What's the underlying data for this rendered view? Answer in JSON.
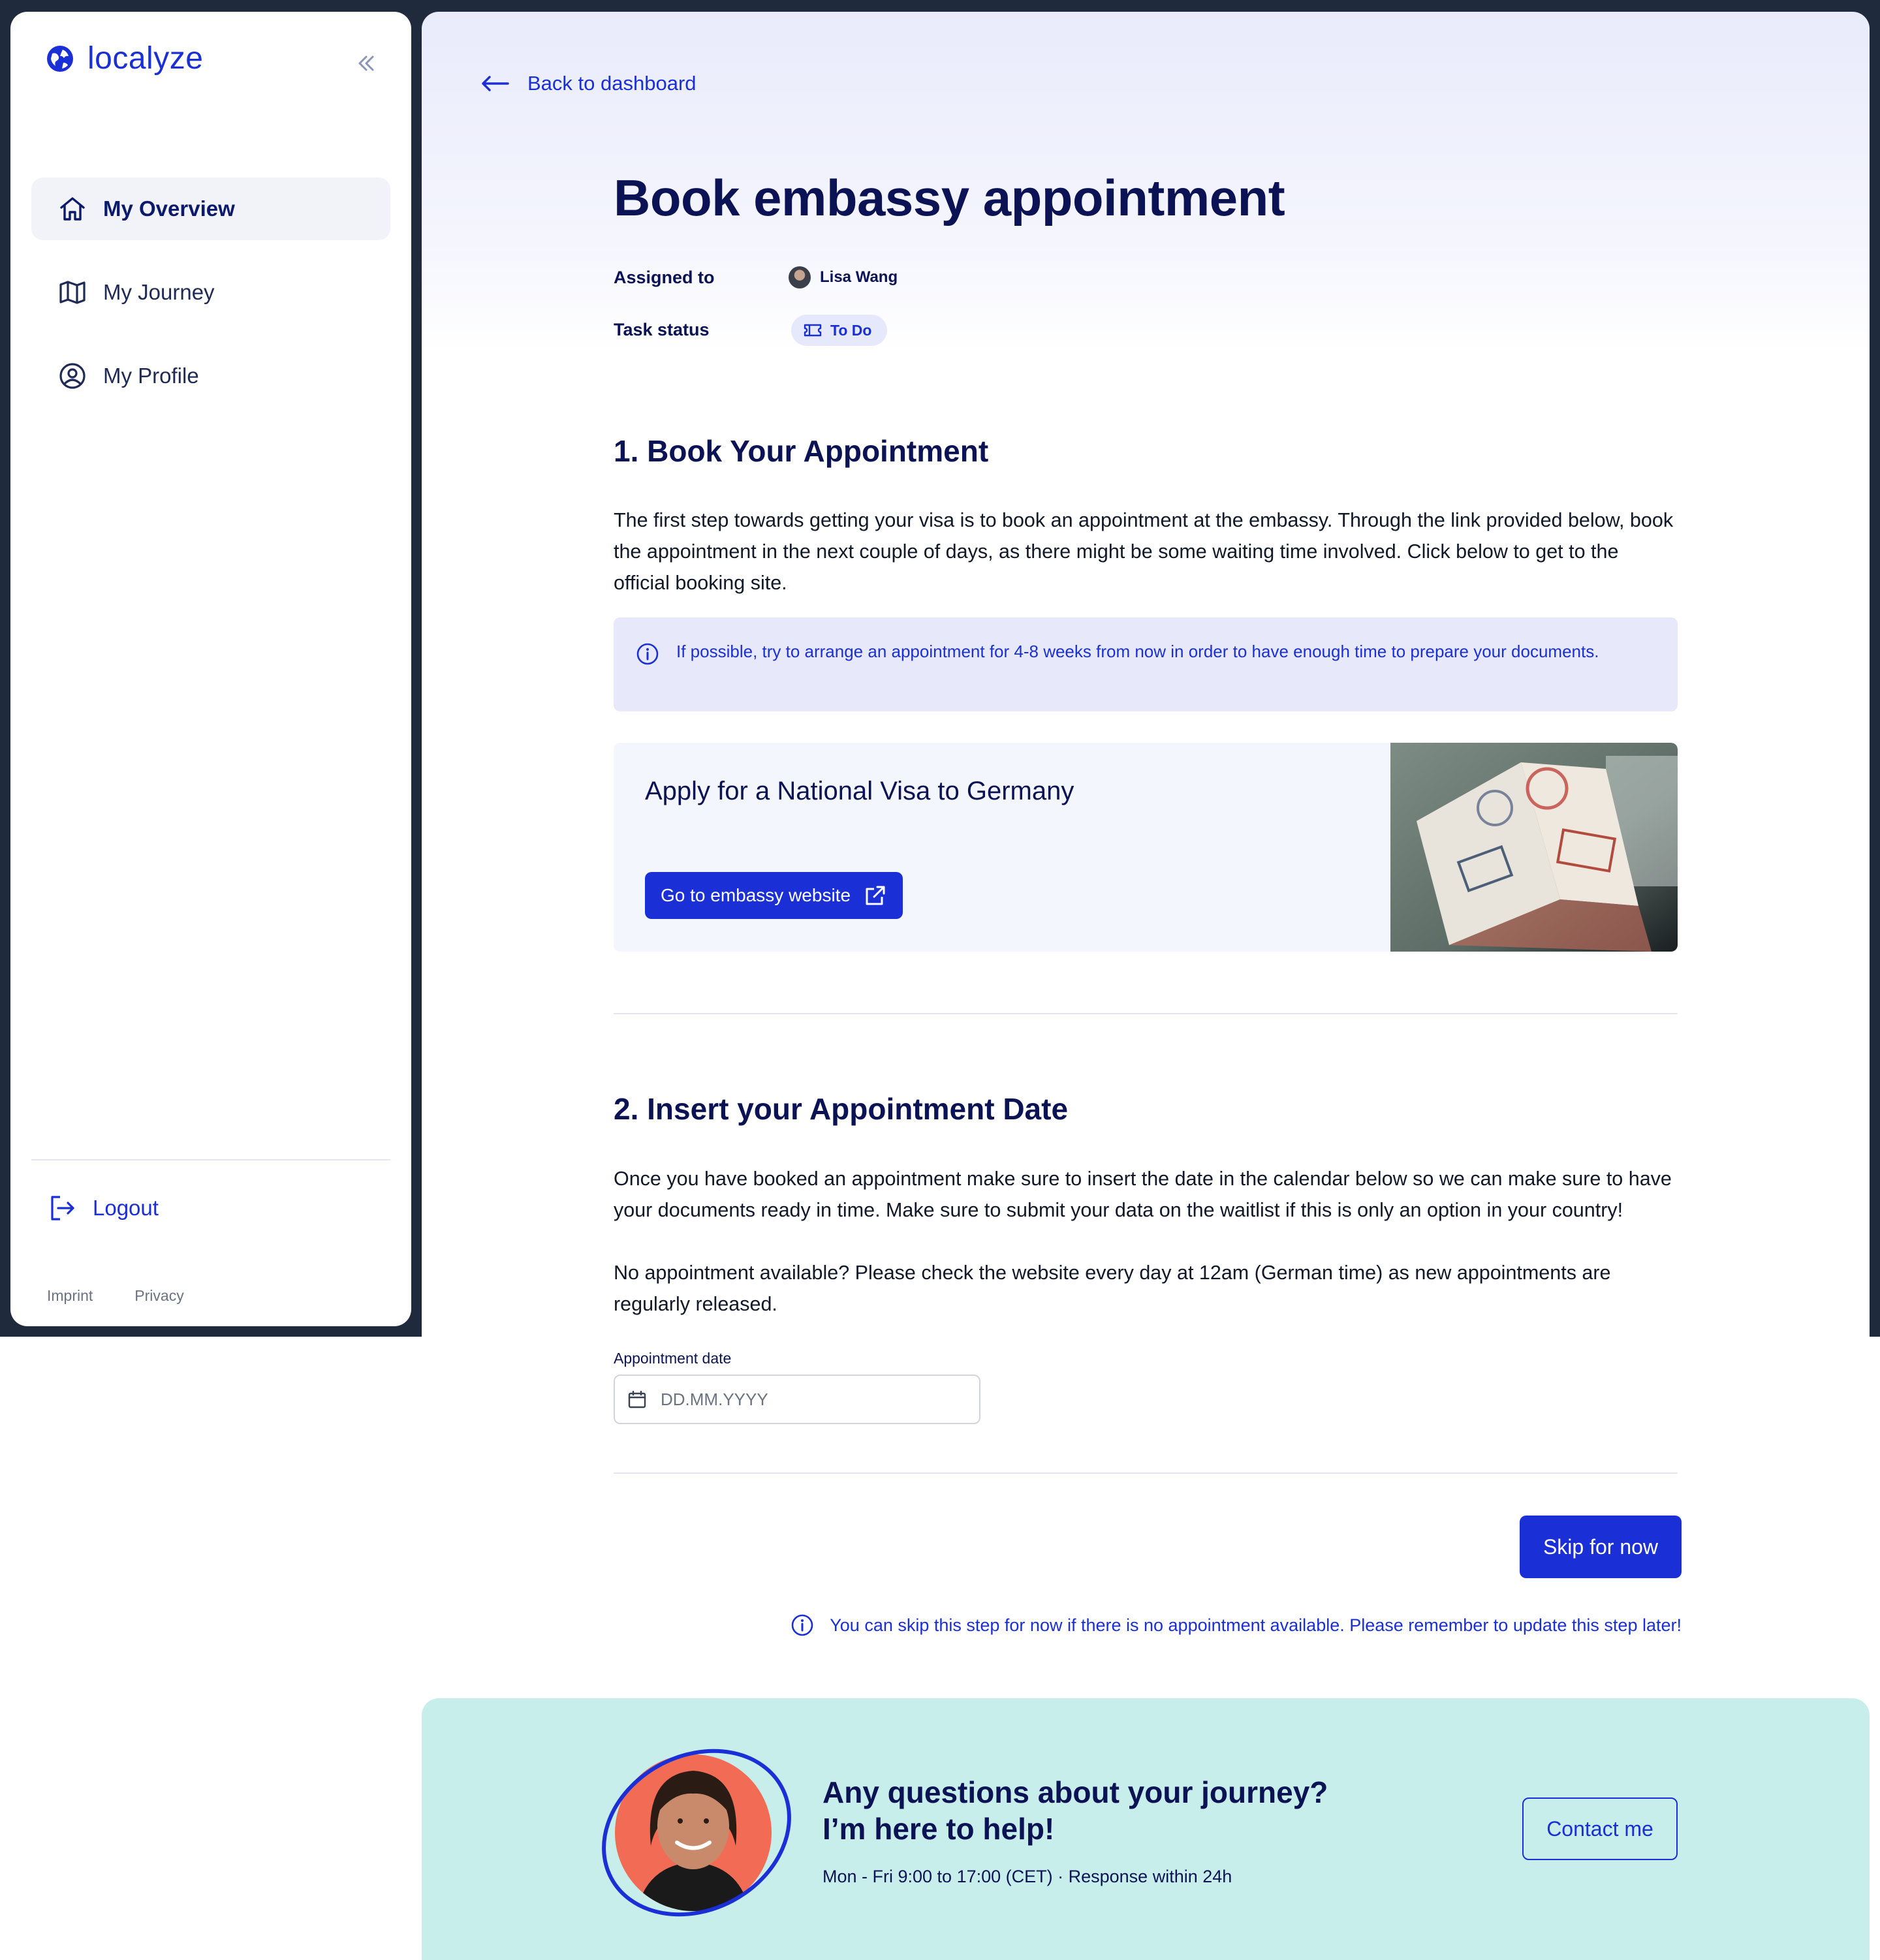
{
  "brand": {
    "name": "localyze"
  },
  "sidebar": {
    "items": [
      {
        "label": "My Overview",
        "icon": "home-icon",
        "active": true
      },
      {
        "label": "My Journey",
        "icon": "map-icon",
        "active": false
      },
      {
        "label": "My Profile",
        "icon": "user-circle-icon",
        "active": false
      }
    ],
    "logout_label": "Logout",
    "footer_links": [
      "Imprint",
      "Privacy"
    ]
  },
  "header": {
    "back_label": "Back to dashboard",
    "title": "Book embassy appointment",
    "assigned_label": "Assigned to",
    "assignee_name": "Lisa Wang",
    "status_label": "Task status",
    "status_value": "To Do"
  },
  "section1": {
    "heading": "1. Book Your Appointment",
    "body": "The first step towards getting your visa is to book an appointment at the embassy. Through the link provided below, book the appointment in the next couple of days, as there might be some waiting time involved. Click below to get to the official booking site.",
    "info": "If possible, try to arrange an appointment for 4-8 weeks from now in order to have enough time to prepare your documents.",
    "card_title": "Apply for a National Visa to Germany",
    "card_button": "Go to embassy website"
  },
  "section2": {
    "heading": "2. Insert your Appointment Date",
    "body_1": "Once you have booked an appointment make sure to insert the date in the calendar below so we can make sure to have your documents ready in time. Make sure to submit your data on the waitlist if this is only an option in your country!",
    "body_2": "No appointment available? Please check the website every day at 12am (German time) as new appointments are regularly released.",
    "field_label": "Appointment date",
    "field_placeholder": "DD.MM.YYYY",
    "field_value": ""
  },
  "actions": {
    "skip_label": "Skip for now",
    "skip_note": "You can skip this step for now if there is no appointment available. Please remember to update this step later!"
  },
  "help": {
    "title_line1": "Any questions about your journey?",
    "title_line2": "I’m here to help!",
    "hours": "Mon - Fri 9:00 to 17:00 (CET) · Response within 24h",
    "contact_label": "Contact me"
  },
  "colors": {
    "accent": "#1a2fd6",
    "navy": "#0c1354",
    "help_bg": "#c8eeec",
    "info_bg": "#e7e9fb",
    "frame": "#1f2a3d"
  }
}
